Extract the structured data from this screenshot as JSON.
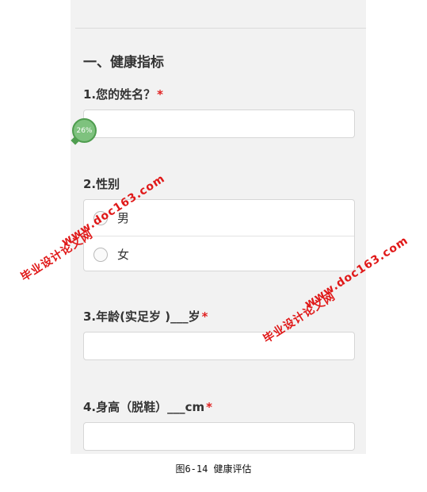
{
  "section": {
    "title": "一、健康指标"
  },
  "questions": [
    {
      "label": "1.您的姓名？",
      "required_mark": "*"
    },
    {
      "label": "2.性别",
      "options": [
        "男",
        "女"
      ]
    },
    {
      "label": "3.年龄(实足岁 )___岁",
      "required_mark": "*"
    },
    {
      "label": "4.身高（脱鞋）___cm",
      "required_mark": "*"
    }
  ],
  "progress": {
    "label": "26%",
    "value_percent": 26
  },
  "watermark": {
    "site": "www.doc163.com",
    "name": "毕业设计论文网"
  },
  "caption": "图6-14 健康评估",
  "colors": {
    "required": "#e02020",
    "progress": "#7ec27e",
    "watermark": "#e01818"
  }
}
